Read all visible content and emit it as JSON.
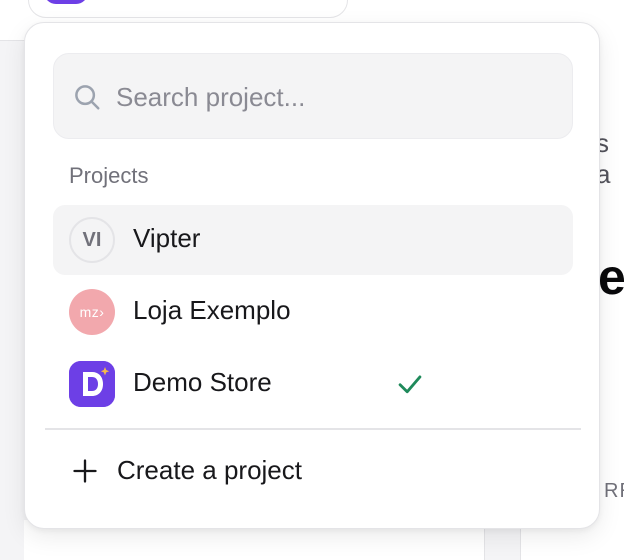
{
  "background": {
    "partial_text_1": "s a",
    "partial_text_2": "e",
    "partial_text_3": "RR"
  },
  "search": {
    "placeholder": "Search project..."
  },
  "projects_section": {
    "label": "Projects",
    "items": [
      {
        "avatar_text": "VI",
        "name": "Vipter",
        "active": true,
        "selected": false
      },
      {
        "avatar_text": "mz›",
        "name": "Loja Exemplo",
        "active": false,
        "selected": false
      },
      {
        "avatar_text": "D",
        "name": "Demo Store",
        "active": false,
        "selected": true
      }
    ]
  },
  "create": {
    "label": "Create a project"
  },
  "colors": {
    "accent_purple": "#6d3fe6",
    "check_green": "#1f8a5b",
    "loja_pink": "#f2a8ad"
  },
  "icons": {
    "search": "search-icon",
    "check": "check-icon",
    "plus": "plus-icon"
  }
}
